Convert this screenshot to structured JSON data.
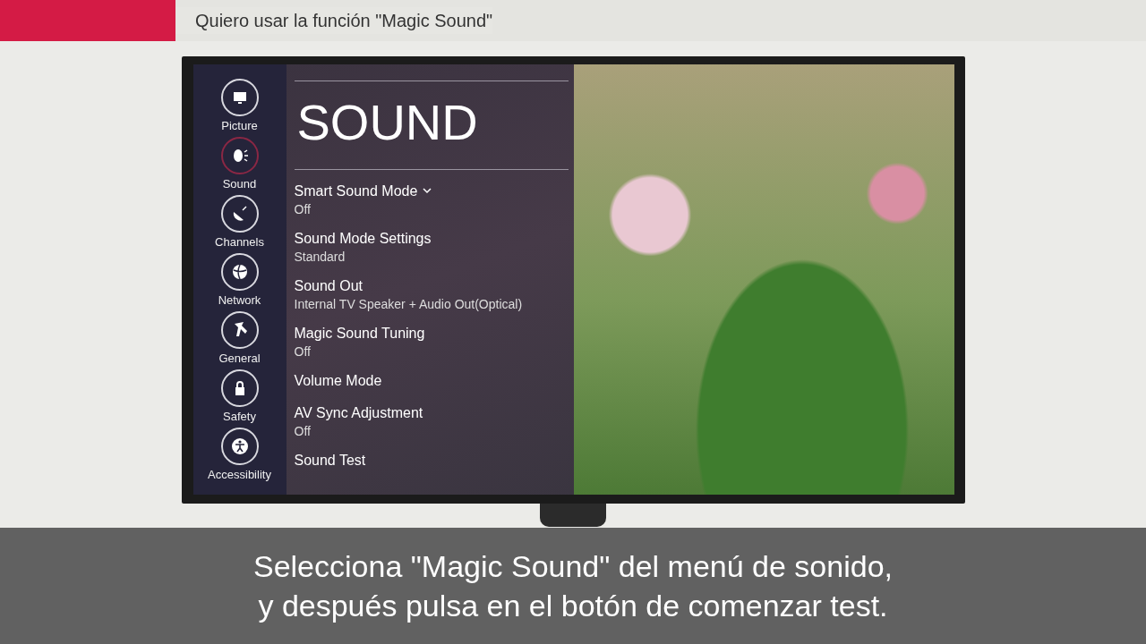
{
  "header": {
    "title": "Quiero usar la función \"Magic Sound\""
  },
  "tv": {
    "sidebar": [
      {
        "label": "Picture",
        "selected": false
      },
      {
        "label": "Sound",
        "selected": true
      },
      {
        "label": "Channels",
        "selected": false
      },
      {
        "label": "Network",
        "selected": false
      },
      {
        "label": "General",
        "selected": false
      },
      {
        "label": "Safety",
        "selected": false
      },
      {
        "label": "Accessibility",
        "selected": false
      }
    ],
    "menu_title": "SOUND",
    "menu_items": [
      {
        "title": "Smart Sound Mode",
        "value": "Off",
        "expandable": true
      },
      {
        "title": "Sound Mode Settings",
        "value": "Standard",
        "expandable": false
      },
      {
        "title": "Sound Out",
        "value": "Internal TV Speaker + Audio Out(Optical)",
        "expandable": false
      },
      {
        "title": "Magic Sound Tuning",
        "value": "Off",
        "expandable": false
      },
      {
        "title": "Volume Mode",
        "expandable": false
      },
      {
        "title": "AV Sync Adjustment",
        "value": "Off",
        "expandable": false
      },
      {
        "title": "Sound Test",
        "expandable": false
      }
    ]
  },
  "subtitle": [
    "Selecciona \"Magic Sound\" del menú de sonido,",
    "y después pulsa en el botón de comenzar test."
  ]
}
